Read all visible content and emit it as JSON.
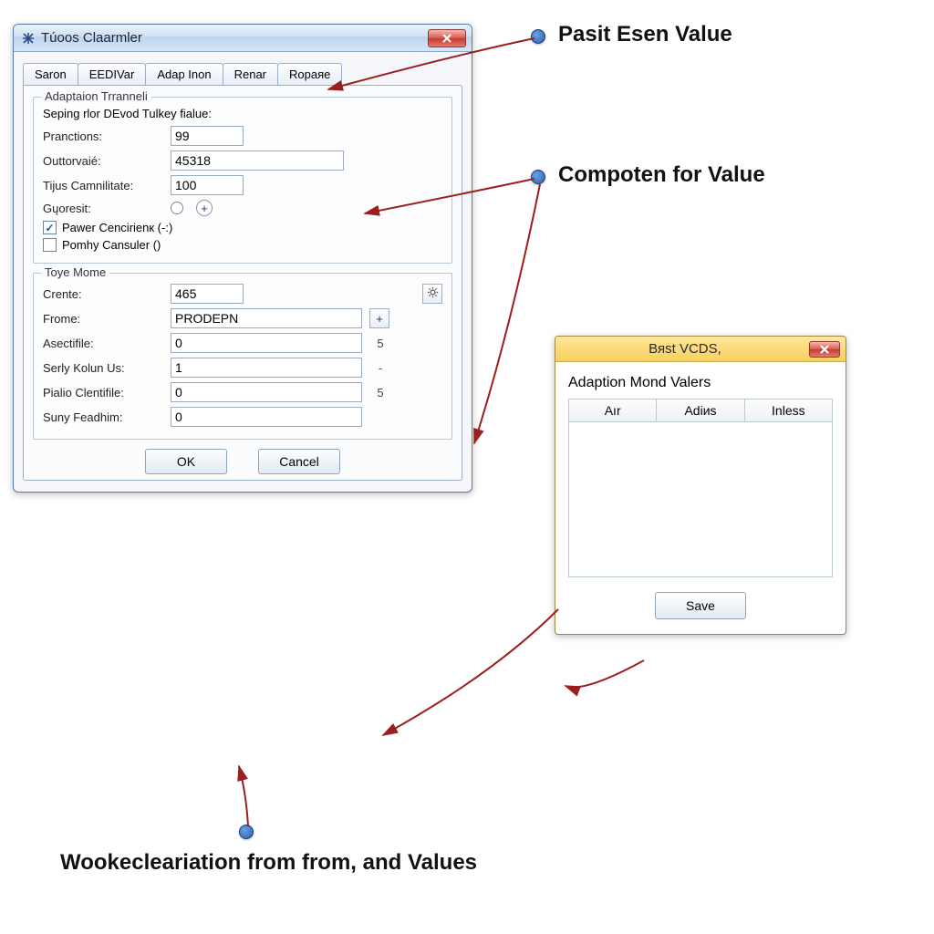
{
  "dialog1": {
    "title": "Túoos Claarmler",
    "tabs": [
      "Saron",
      "EEDIVar",
      "Adap Inon",
      "Renar",
      "Roраяе"
    ],
    "group1": {
      "legend": "Adaptaion Trranneli",
      "subtitle": "Seping rlor DEvod Tulkey fialue:",
      "rows": {
        "pranctions_label": "Pranctions:",
        "pranctions_value": "99",
        "outtorvale_label": "Outtorvaié:",
        "outtorvale_value": "45318",
        "tijus_label": "Tijus Camnilitate:",
        "tijus_value": "100",
        "guoresit_label": "Gųoresit:"
      },
      "check1_label": "Pawer Cencirienк (-:)",
      "check1_checked": "✓",
      "check2_label": "Pomhy Cansuler ()"
    },
    "group2": {
      "legend": "Toye Mome",
      "rows": [
        {
          "label": "Crente:",
          "value": "465",
          "suffix": "",
          "btn": "gear"
        },
        {
          "label": "Frome:",
          "value": "PRODEPN",
          "suffix": "",
          "btn": "plus"
        },
        {
          "label": "Asectifile:",
          "value": "0",
          "suffix": "5",
          "btn": ""
        },
        {
          "label": "Serly Kolun Us:",
          "value": "1",
          "suffix": "-",
          "btn": ""
        },
        {
          "label": "Pialio Clentifile:",
          "value": "0",
          "suffix": "5",
          "btn": ""
        },
        {
          "label": "Suny Feadhim:",
          "value": "0",
          "suffix": "",
          "btn": ""
        }
      ]
    },
    "ok_label": "OK",
    "cancel_label": "Cancel"
  },
  "dialog2": {
    "title": "Вяst VCDS,",
    "heading": "Adaption Mond Valers",
    "cols": [
      "Aır",
      "Adiиs",
      "Inleѕs"
    ],
    "save_label": "Save"
  },
  "callouts": {
    "c1": "Pasit Esen Value",
    "c2": "Compoten for Value",
    "c3": "Wookecleariation from from, and Values"
  }
}
